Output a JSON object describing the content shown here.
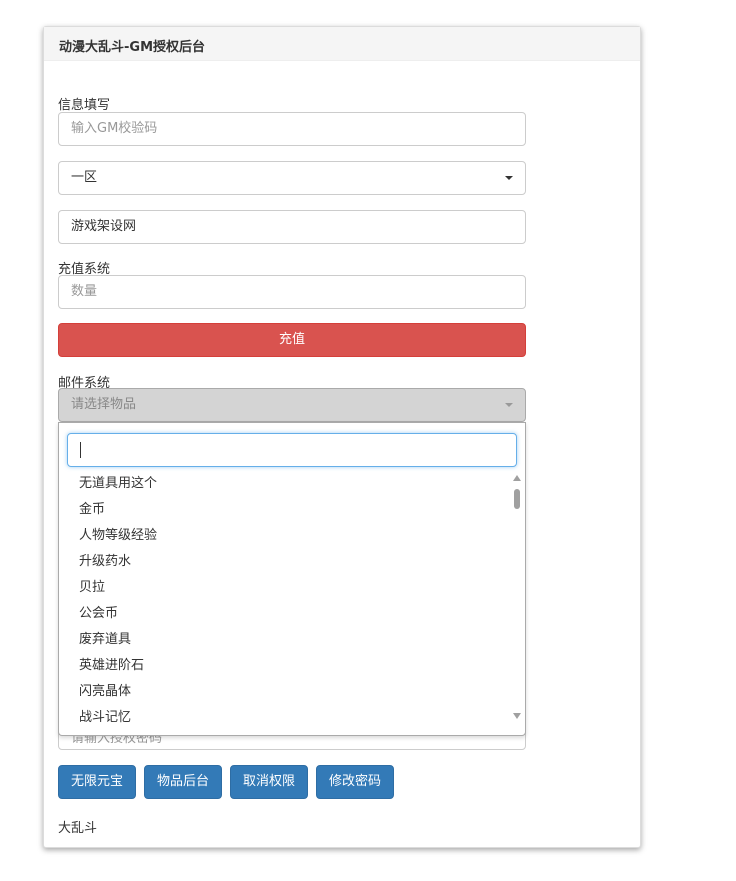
{
  "header": {
    "title": "动漫大乱斗-GM授权后台"
  },
  "info": {
    "label": "信息填写",
    "gm_code_placeholder": "输入GM校验码",
    "server_selected": "一区",
    "account_value": "游戏架设网"
  },
  "recharge": {
    "label": "充值系统",
    "amount_placeholder": "数量",
    "button_label": "充值"
  },
  "mail": {
    "label": "邮件系统",
    "item_select_placeholder": "请选择物品",
    "obscured_placeholder": "请输入授权密码",
    "dropdown_items": [
      "无道具用这个",
      "金币",
      "人物等级经验",
      "升级药水",
      "贝拉",
      "公会币",
      "废弃道具",
      "英雄进阶石",
      "闪亮晶体",
      "战斗记忆"
    ]
  },
  "buttons": {
    "unlimited_gems": "无限元宝",
    "items_backend": "物品后台",
    "revoke_permission": "取消权限",
    "change_password": "修改密码"
  },
  "footer": {
    "text": "大乱斗"
  },
  "colors": {
    "danger": "#d9534f",
    "primary": "#337ab7",
    "focus": "#66afe9"
  }
}
